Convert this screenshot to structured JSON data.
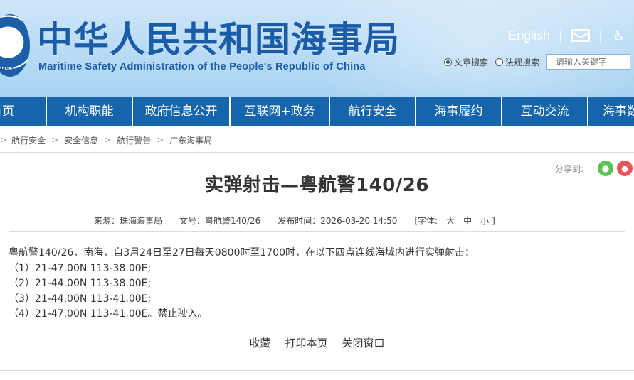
{
  "header": {
    "title": "中华人民共和国海事局",
    "subtitle": "Maritime Safety Administration of the People's Republic of China",
    "emblem_text": "MSA",
    "english_link": "English",
    "separator": "|"
  },
  "search": {
    "options": [
      {
        "label": "文章搜索",
        "selected": true
      },
      {
        "label": "法规搜索",
        "selected": false
      }
    ],
    "placeholder": "请输入关键字"
  },
  "nav": {
    "items": [
      "首页",
      "机构职能",
      "政府信息公开",
      "互联网+政务",
      "航行安全",
      "海事履约",
      "互动交流",
      "海事数"
    ]
  },
  "breadcrumb": {
    "separator": ">",
    "items": [
      "航行安全",
      "安全信息",
      "航行警告",
      "广东海事局"
    ]
  },
  "share": {
    "label": "分享到:"
  },
  "article": {
    "title": "实弹射击—粤航警140/26",
    "meta": {
      "source": "来源：珠海海事局",
      "doc_no": "文号：粤航警140/26",
      "published": "发布时间：2026-03-20 14:50",
      "font_open": "[字体:",
      "font_large": "大",
      "font_medium": "中",
      "font_small": "小",
      "font_close": "]"
    },
    "paragraphs": [
      "粤航警140/26，南海，自3月24日至27日每天0800时至1700时，在以下四点连线海域内进行实弹射击：",
      "（1）21-47.00N 113-38.00E;",
      "（2）21-44.00N 113-38.00E;",
      "（3）21-44.00N 113-41.00E;",
      "（4）21-47.00N 113-41.00E。禁止驶入。"
    ]
  },
  "actions": {
    "favorite": "收藏",
    "print": "打印本页",
    "close": "关闭窗口"
  },
  "colors": {
    "brand_blue": "#1565ad",
    "title_blue": "#1a5ca8"
  }
}
